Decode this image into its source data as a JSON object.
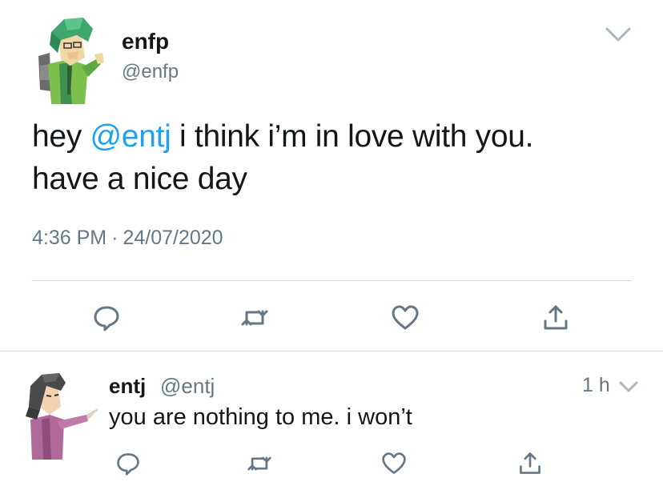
{
  "main_tweet": {
    "author": {
      "name": "enfp",
      "handle": "@enfp"
    },
    "text_before": "hey ",
    "mention": "@entj",
    "text_line1_after": " i think i’m in love with you.",
    "text_line2": "have a nice day",
    "time": "4:36 PM",
    "separator": "·",
    "date": "24/07/2020",
    "actions": [
      "reply-icon",
      "retweet-icon",
      "heart-icon",
      "share-icon"
    ]
  },
  "reply": {
    "author": {
      "name": "entj",
      "handle": "@entj"
    },
    "time_ago": "1 h",
    "text": "you are nothing to me. i won’t",
    "actions": [
      "reply-icon",
      "retweet-icon",
      "heart-icon",
      "share-icon"
    ]
  },
  "colors": {
    "mention": "#1da1f2",
    "secondary_text": "#657786",
    "primary_text": "#14171a",
    "divider": "#ccd6dd",
    "icon": "#657786"
  }
}
